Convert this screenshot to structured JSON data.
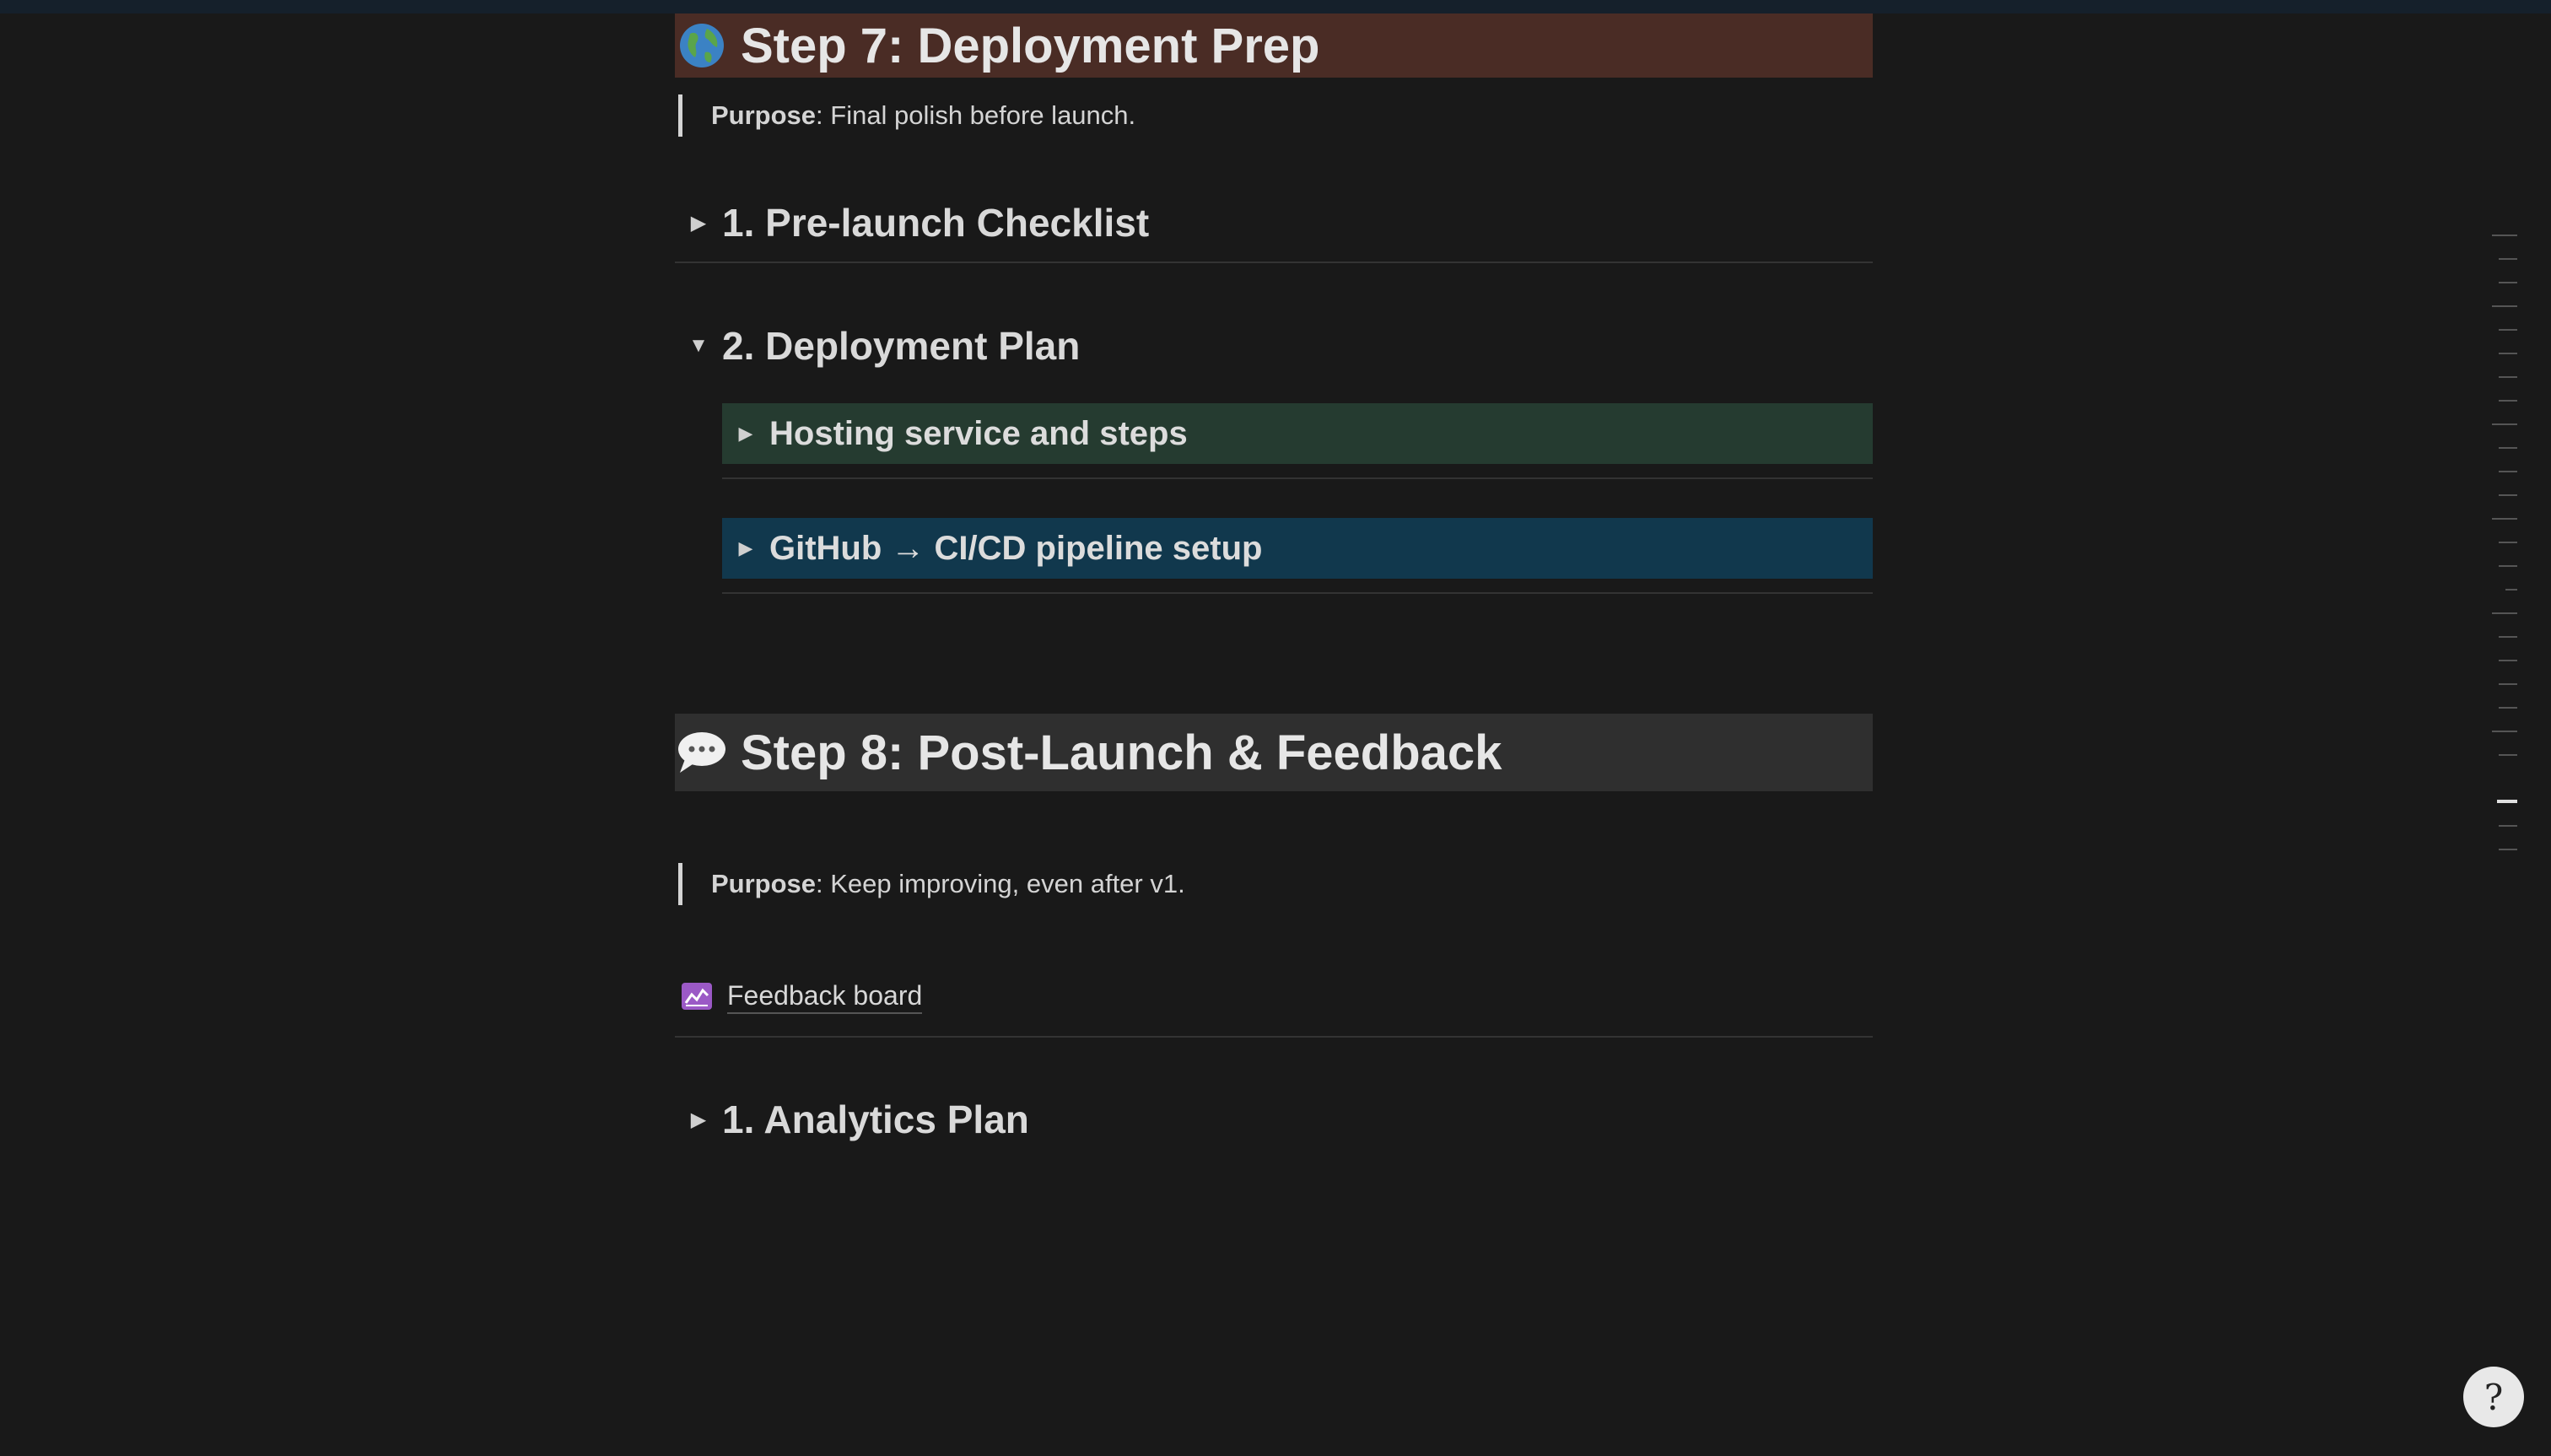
{
  "sections": {
    "deployment": {
      "emoji": "🌍",
      "title": "Step 7: Deployment Prep",
      "purpose_label": "Purpose",
      "purpose_text": ": Final polish before launch.",
      "toggles": [
        {
          "label": "1. Pre-launch Checklist",
          "expanded": false
        },
        {
          "label": "2. Deployment Plan",
          "expanded": true
        }
      ],
      "sub_toggles": [
        {
          "label": "Hosting service and steps",
          "color": "#253b30"
        },
        {
          "label": "GitHub → CI/CD pipeline setup",
          "color": "#11384d"
        }
      ]
    },
    "post_launch": {
      "emoji": "💬",
      "title": "Step 8: Post-Launch & Feedback",
      "purpose_label": "Purpose",
      "purpose_text": ": Keep improving, even after v1.",
      "link": {
        "icon": "chart-line-icon",
        "label": "Feedback board"
      },
      "toggles": [
        {
          "label": "1. Analytics Plan",
          "expanded": false
        }
      ]
    }
  },
  "icons": {
    "collapsed": "▶",
    "expanded": "▼",
    "help": "?"
  }
}
